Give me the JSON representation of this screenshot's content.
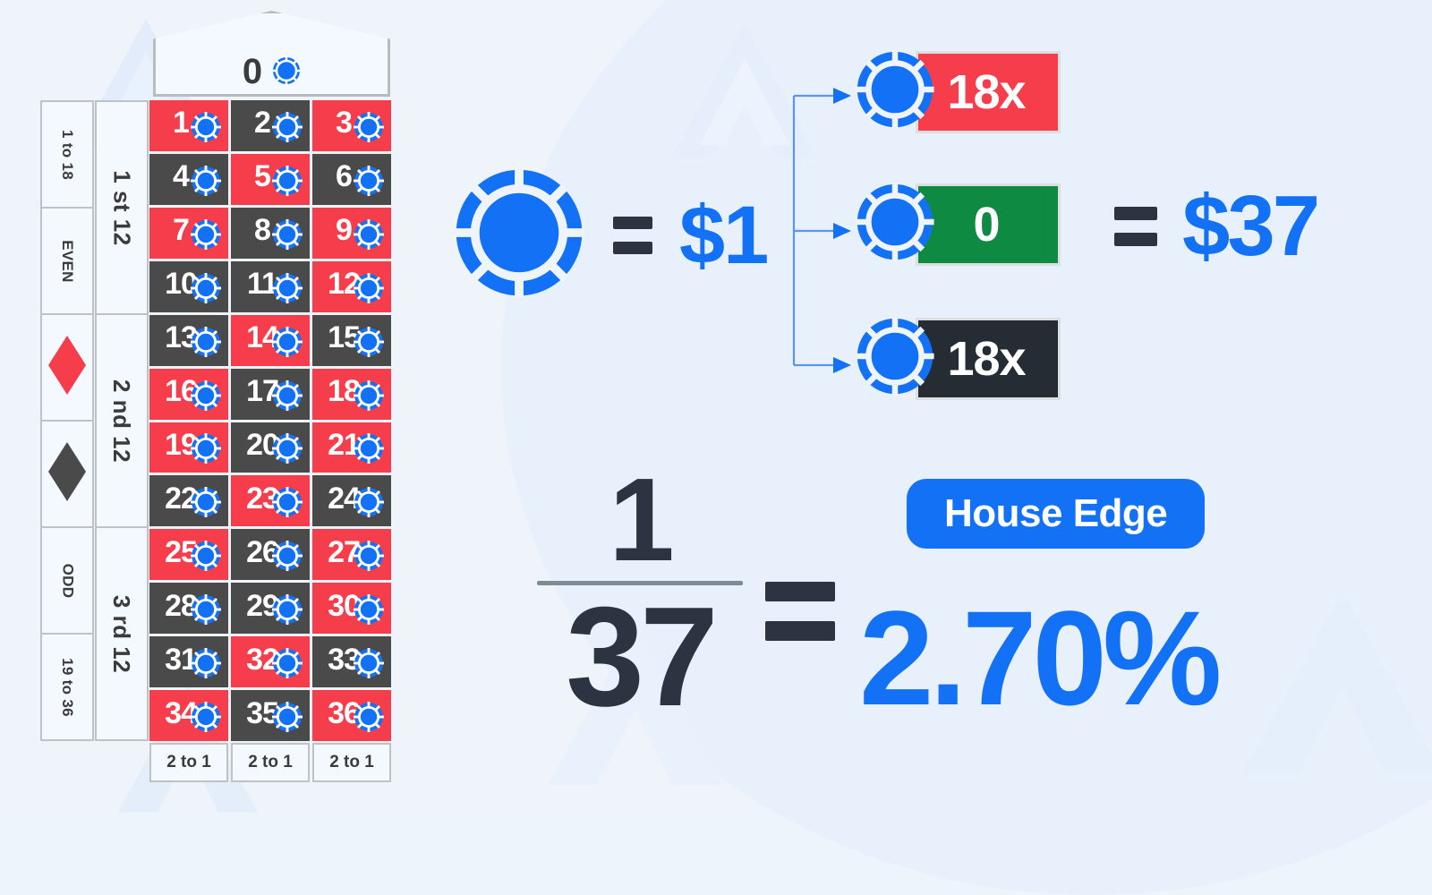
{
  "colors": {
    "background": "#eef4fb",
    "accent_blue": "#1271f5",
    "red": "#f63d4b",
    "black": "#4a4a4a",
    "green": "#0e8a42",
    "badge_black": "#262c33",
    "dark_text": "#2b3440",
    "border_gray": "#bfc2c5"
  },
  "table": {
    "zero": {
      "label": "0",
      "chip": "chip-icon"
    },
    "outside_bets": [
      {
        "type": "text",
        "label": "1 to 18"
      },
      {
        "type": "text",
        "label": "EVEN"
      },
      {
        "type": "diamond",
        "label": "RED",
        "color": "#f63d4b"
      },
      {
        "type": "diamond",
        "label": "BLACK",
        "color": "#4a4a4a"
      },
      {
        "type": "text",
        "label": "ODD"
      },
      {
        "type": "text",
        "label": "19 to 36"
      }
    ],
    "dozens": [
      {
        "label": "1 st 12"
      },
      {
        "label": "2 nd 12"
      },
      {
        "label": "3 rd 12"
      }
    ],
    "numbers": [
      {
        "n": "1",
        "color": "red"
      },
      {
        "n": "2",
        "color": "black"
      },
      {
        "n": "3",
        "color": "red"
      },
      {
        "n": "4",
        "color": "black"
      },
      {
        "n": "5",
        "color": "red"
      },
      {
        "n": "6",
        "color": "black"
      },
      {
        "n": "7",
        "color": "red"
      },
      {
        "n": "8",
        "color": "black"
      },
      {
        "n": "9",
        "color": "red"
      },
      {
        "n": "10",
        "color": "black"
      },
      {
        "n": "11",
        "color": "black"
      },
      {
        "n": "12",
        "color": "red"
      },
      {
        "n": "13",
        "color": "black"
      },
      {
        "n": "14",
        "color": "red"
      },
      {
        "n": "15",
        "color": "black"
      },
      {
        "n": "16",
        "color": "red"
      },
      {
        "n": "17",
        "color": "black"
      },
      {
        "n": "18",
        "color": "red"
      },
      {
        "n": "19",
        "color": "red"
      },
      {
        "n": "20",
        "color": "black"
      },
      {
        "n": "21",
        "color": "red"
      },
      {
        "n": "22",
        "color": "black"
      },
      {
        "n": "23",
        "color": "red"
      },
      {
        "n": "24",
        "color": "black"
      },
      {
        "n": "25",
        "color": "red"
      },
      {
        "n": "26",
        "color": "black"
      },
      {
        "n": "27",
        "color": "red"
      },
      {
        "n": "28",
        "color": "black"
      },
      {
        "n": "29",
        "color": "black"
      },
      {
        "n": "30",
        "color": "red"
      },
      {
        "n": "31",
        "color": "black"
      },
      {
        "n": "32",
        "color": "red"
      },
      {
        "n": "33",
        "color": "black"
      },
      {
        "n": "34",
        "color": "red"
      },
      {
        "n": "35",
        "color": "black"
      },
      {
        "n": "36",
        "color": "red"
      }
    ],
    "column_bets": [
      {
        "label": "2 to 1"
      },
      {
        "label": "2 to 1"
      },
      {
        "label": "2 to 1"
      }
    ]
  },
  "chip_value": {
    "equals": "=",
    "amount": "$1"
  },
  "multipliers": [
    {
      "badge_label": "18x",
      "badge_color": "red",
      "chip": "chip-icon"
    },
    {
      "badge_label": "0",
      "badge_color": "green",
      "chip": "chip-icon"
    },
    {
      "badge_label": "18x",
      "badge_color": "black",
      "chip": "chip-icon"
    }
  ],
  "total": {
    "equals": "=",
    "amount": "$37"
  },
  "formula": {
    "numerator": "1",
    "denominator": "37",
    "equals": "=",
    "result": "2.70%"
  },
  "house_edge": {
    "pill_label": "House Edge"
  }
}
